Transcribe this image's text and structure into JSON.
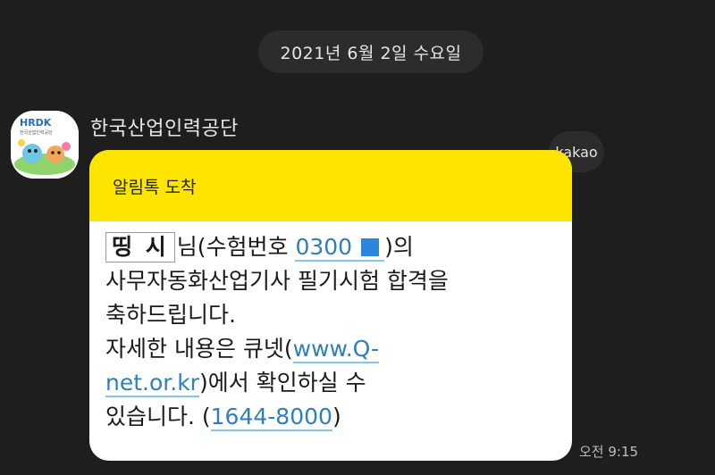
{
  "date_divider": "2021년 6월 2일 수요일",
  "sender": {
    "name": "한국산업인력공단",
    "avatar_label": "HRDK",
    "avatar_sublabel": "한국산업인력공단"
  },
  "badge": "kakao",
  "message": {
    "header": "알림톡 도착",
    "recipient_name": "띵 시",
    "line1_after_name": "님(수험번호",
    "exam_number": "0300",
    "line1_close": ")의",
    "line2": "사무자동화산업기사 필기시험 합격을",
    "line3": "축하드립니다.",
    "line4_prefix": "자세한 내용은 큐넷(",
    "link_part1": "www.Q-",
    "link_part2": "net.or.kr",
    "line5_suffix": ")에서 확인하실 수",
    "line6_prefix": "있습니다. (",
    "phone": "1644-8000",
    "line6_suffix": ")"
  },
  "timestamp": "오전 9:15",
  "colors": {
    "background": "#1e1e1e",
    "header_yellow": "#fee500",
    "link_blue": "#2f7fb8"
  }
}
